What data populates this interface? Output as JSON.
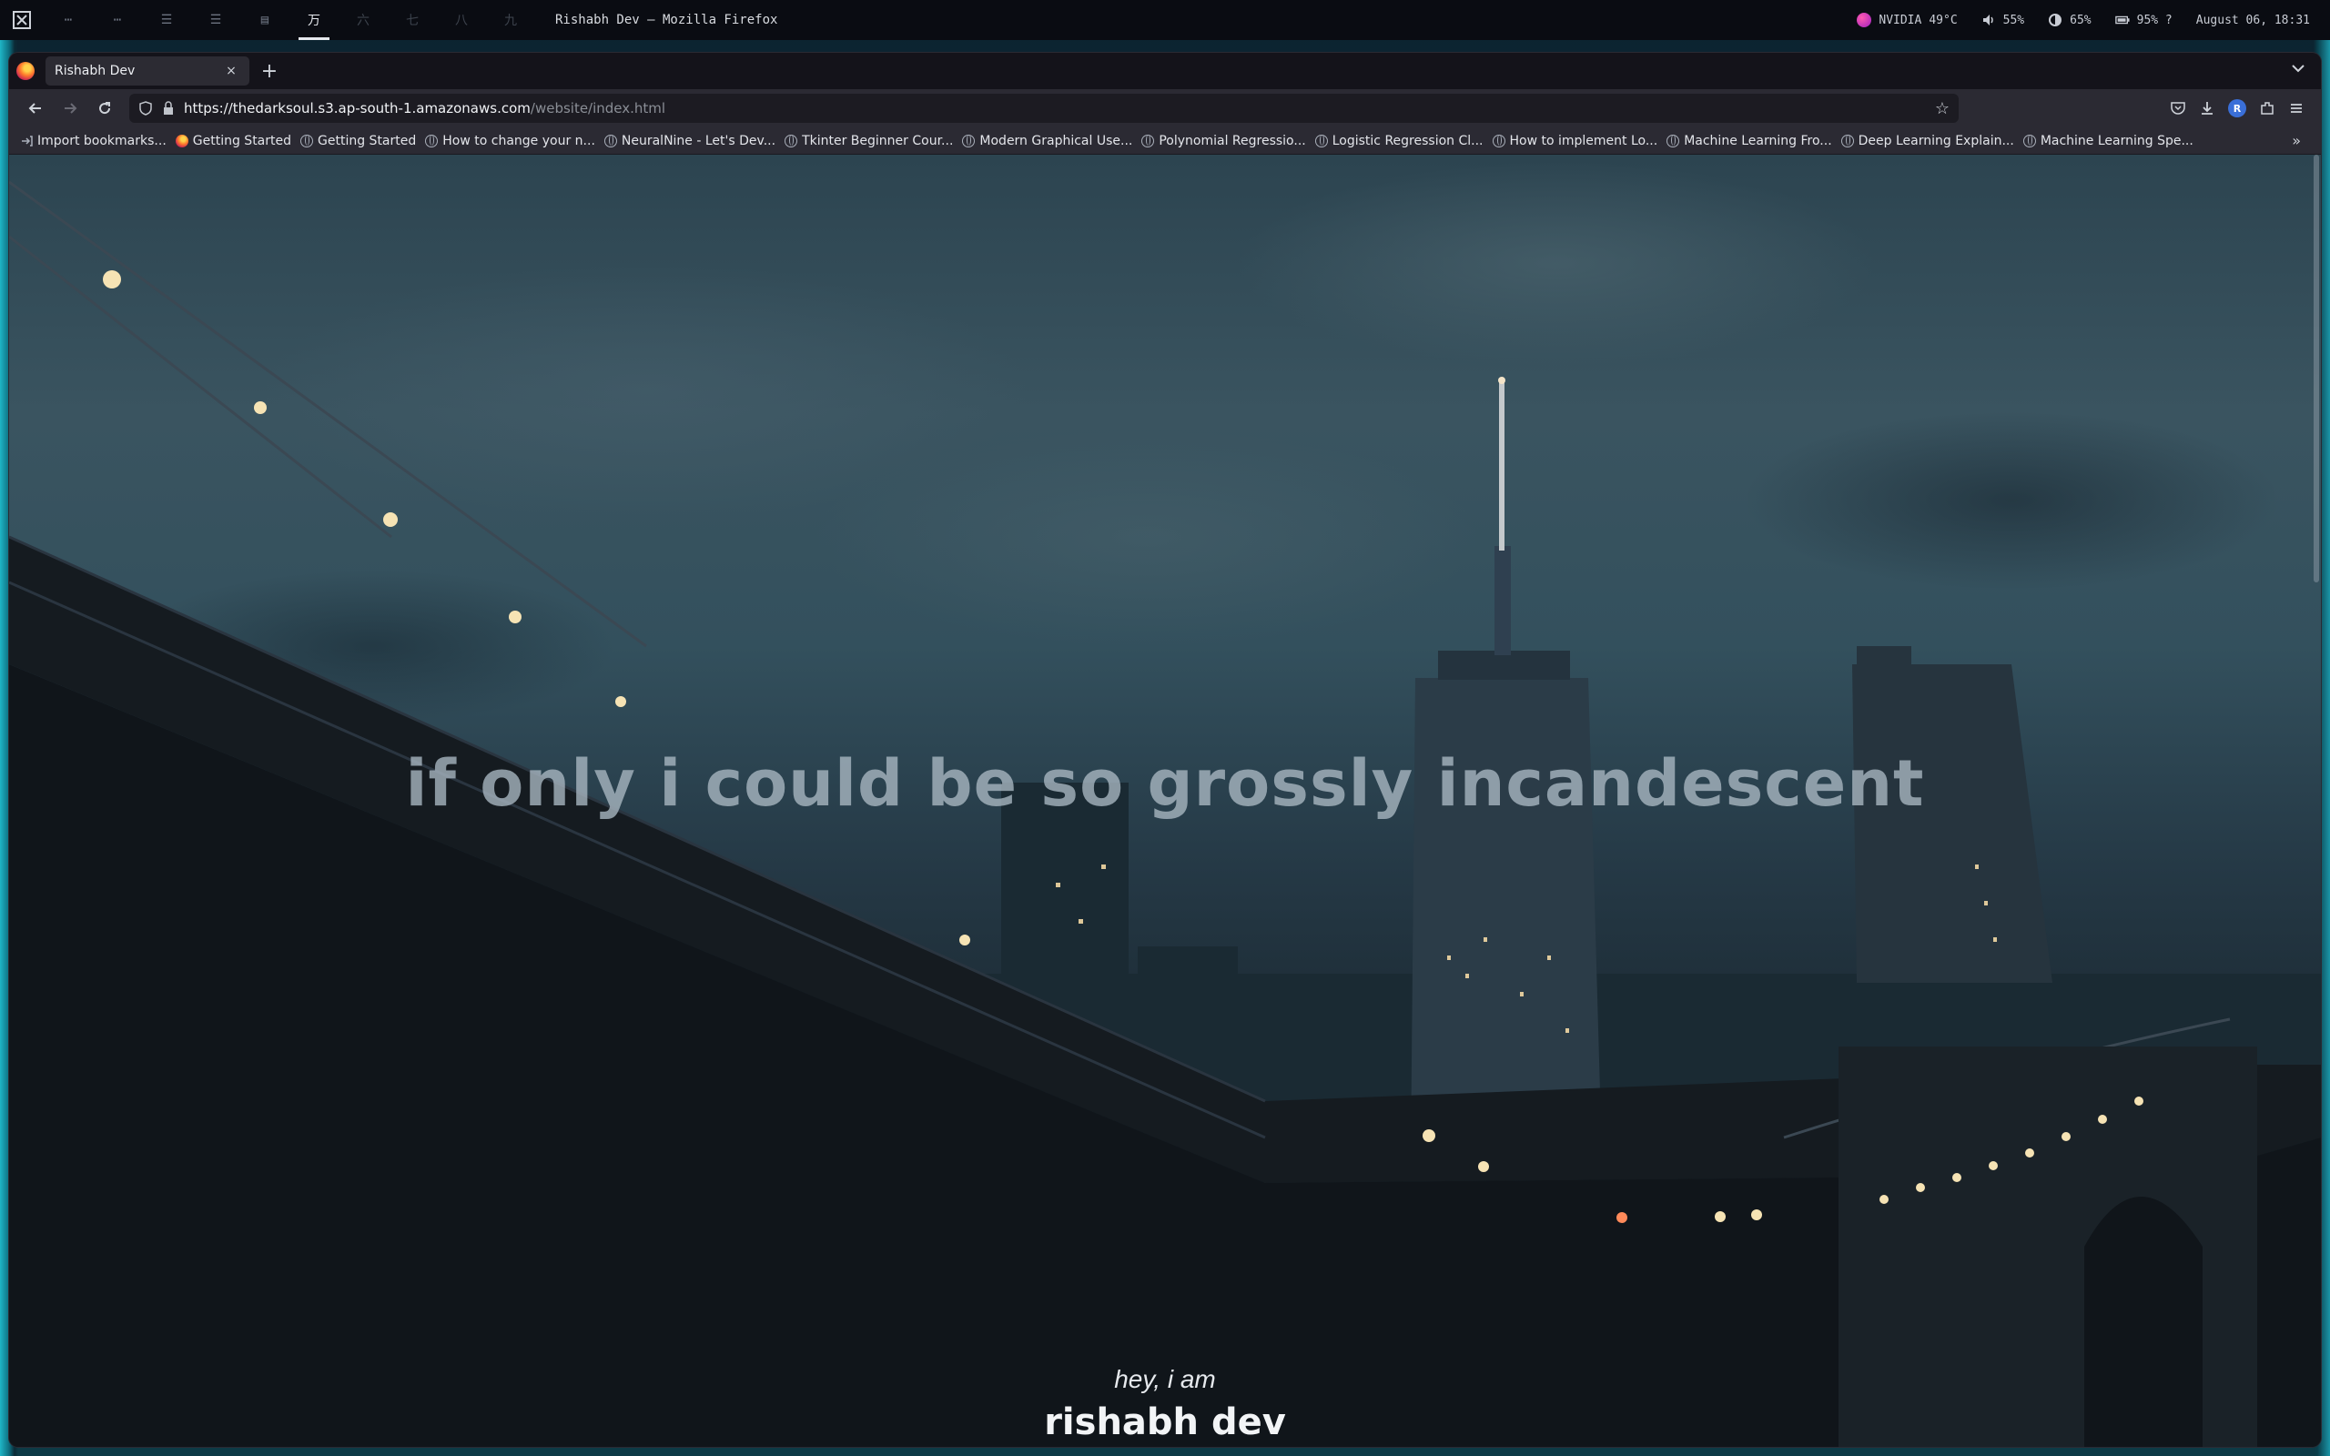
{
  "topbar": {
    "workspaces": [
      "⋯",
      "⋯",
      "☰",
      "☰",
      "▤",
      "万",
      "六",
      "七",
      "八",
      "九"
    ],
    "window_title": "Rishabh Dev — Mozilla Firefox",
    "gpu_label": "NVIDIA",
    "gpu_temp": "49°C",
    "volume": "55%",
    "brightness": "65%",
    "battery": "95% ?",
    "datetime": "August 06, 18:31"
  },
  "browser": {
    "tab_title": "Rishabh Dev",
    "tab_close": "×",
    "new_tab": "+",
    "url_host": "https://thedarksoul.s3.ap-south-1.amazonaws.com",
    "url_path": "/website/index.html",
    "bookmarks": [
      {
        "label": "Import bookmarks...",
        "icon": "import-icon"
      },
      {
        "label": "Getting Started",
        "icon": "firefox-icon"
      },
      {
        "label": "Getting Started",
        "icon": "globe-icon"
      },
      {
        "label": "How to change your n...",
        "icon": "globe-icon"
      },
      {
        "label": "NeuralNine - Let's Dev...",
        "icon": "globe-icon"
      },
      {
        "label": "Tkinter Beginner Cour...",
        "icon": "globe-icon"
      },
      {
        "label": "Modern Graphical Use...",
        "icon": "globe-icon"
      },
      {
        "label": "Polynomial Regressio...",
        "icon": "globe-icon"
      },
      {
        "label": "Logistic Regression Cl...",
        "icon": "globe-icon"
      },
      {
        "label": "How to implement Lo...",
        "icon": "globe-icon"
      },
      {
        "label": "Machine Learning Fro...",
        "icon": "globe-icon"
      },
      {
        "label": "Deep Learning Explain...",
        "icon": "globe-icon"
      },
      {
        "label": "Machine Learning Spe...",
        "icon": "globe-icon"
      }
    ]
  },
  "page": {
    "headline": "if only i could be so grossly incandescent",
    "intro": "hey, i am",
    "name": "rishabh dev"
  }
}
